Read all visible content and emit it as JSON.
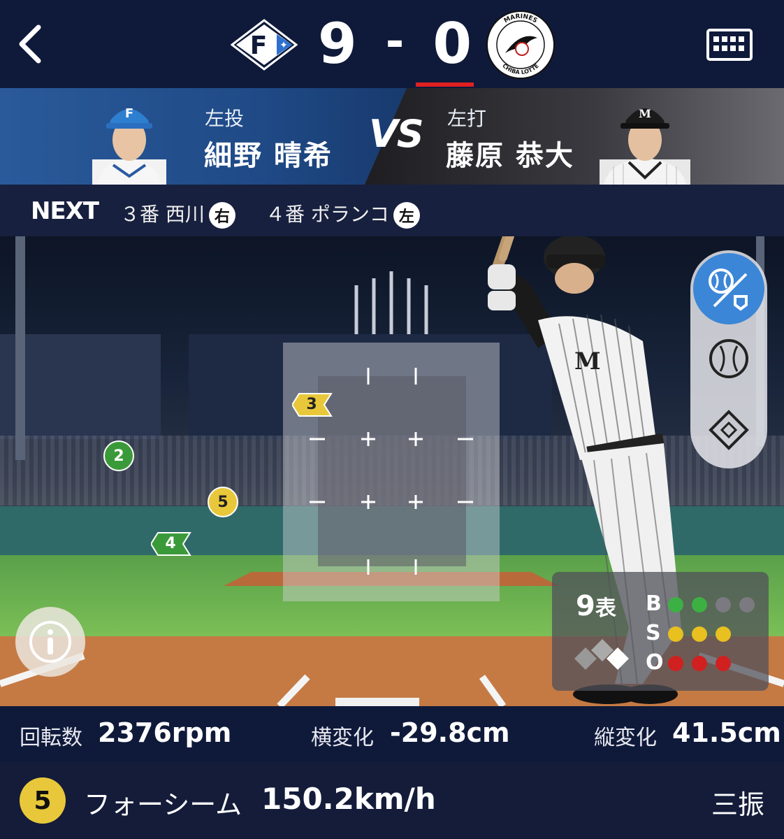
{
  "header": {
    "home_logo_letter": "F",
    "score_home": "9",
    "score_sep": "-",
    "score_away": "0",
    "away_logo_top": "MARINES",
    "away_logo_bottom": "CHIBA LOTTE"
  },
  "matchup": {
    "pitcher_hand": "左投",
    "pitcher_name": "細野 晴希",
    "vs": "VS",
    "batter_hand": "左打",
    "batter_name": "藤原 恭大"
  },
  "next": {
    "label": "NEXT",
    "items": [
      {
        "order": "３番 西川",
        "hand": "右"
      },
      {
        "order": "４番 ポランコ",
        "hand": "左"
      }
    ]
  },
  "pitches": [
    {
      "no": "2",
      "kind": "circle",
      "color": "#3a9a3a"
    },
    {
      "no": "3",
      "kind": "arrow",
      "color": "#e8c83a"
    },
    {
      "no": "4",
      "kind": "arrow",
      "color": "#3a9a3a"
    },
    {
      "no": "5",
      "kind": "circle",
      "color": "#e8c83a"
    }
  ],
  "count": {
    "inning": "9",
    "half": "表",
    "balls_label": "B",
    "strikes_label": "S",
    "outs_label": "O",
    "balls": 2,
    "strikes": 3,
    "outs": 3
  },
  "stats": {
    "spin_label": "回転数",
    "spin_value": "2376rpm",
    "hbreak_label": "横変化",
    "hbreak_value": "-29.8cm",
    "vbreak_label": "縦変化",
    "vbreak_value": "41.5cm"
  },
  "footer": {
    "pitch_no": "5",
    "pitch_type": "フォーシーム",
    "speed": "150.2km/h",
    "result": "三振"
  },
  "colors": {
    "header_bg": "#0f1a3a",
    "score_underline": "#e02020",
    "ball_color": "#3cb043",
    "strike_color": "#e8c020",
    "out_color": "#d02020",
    "active_view": "#3b86d6"
  }
}
